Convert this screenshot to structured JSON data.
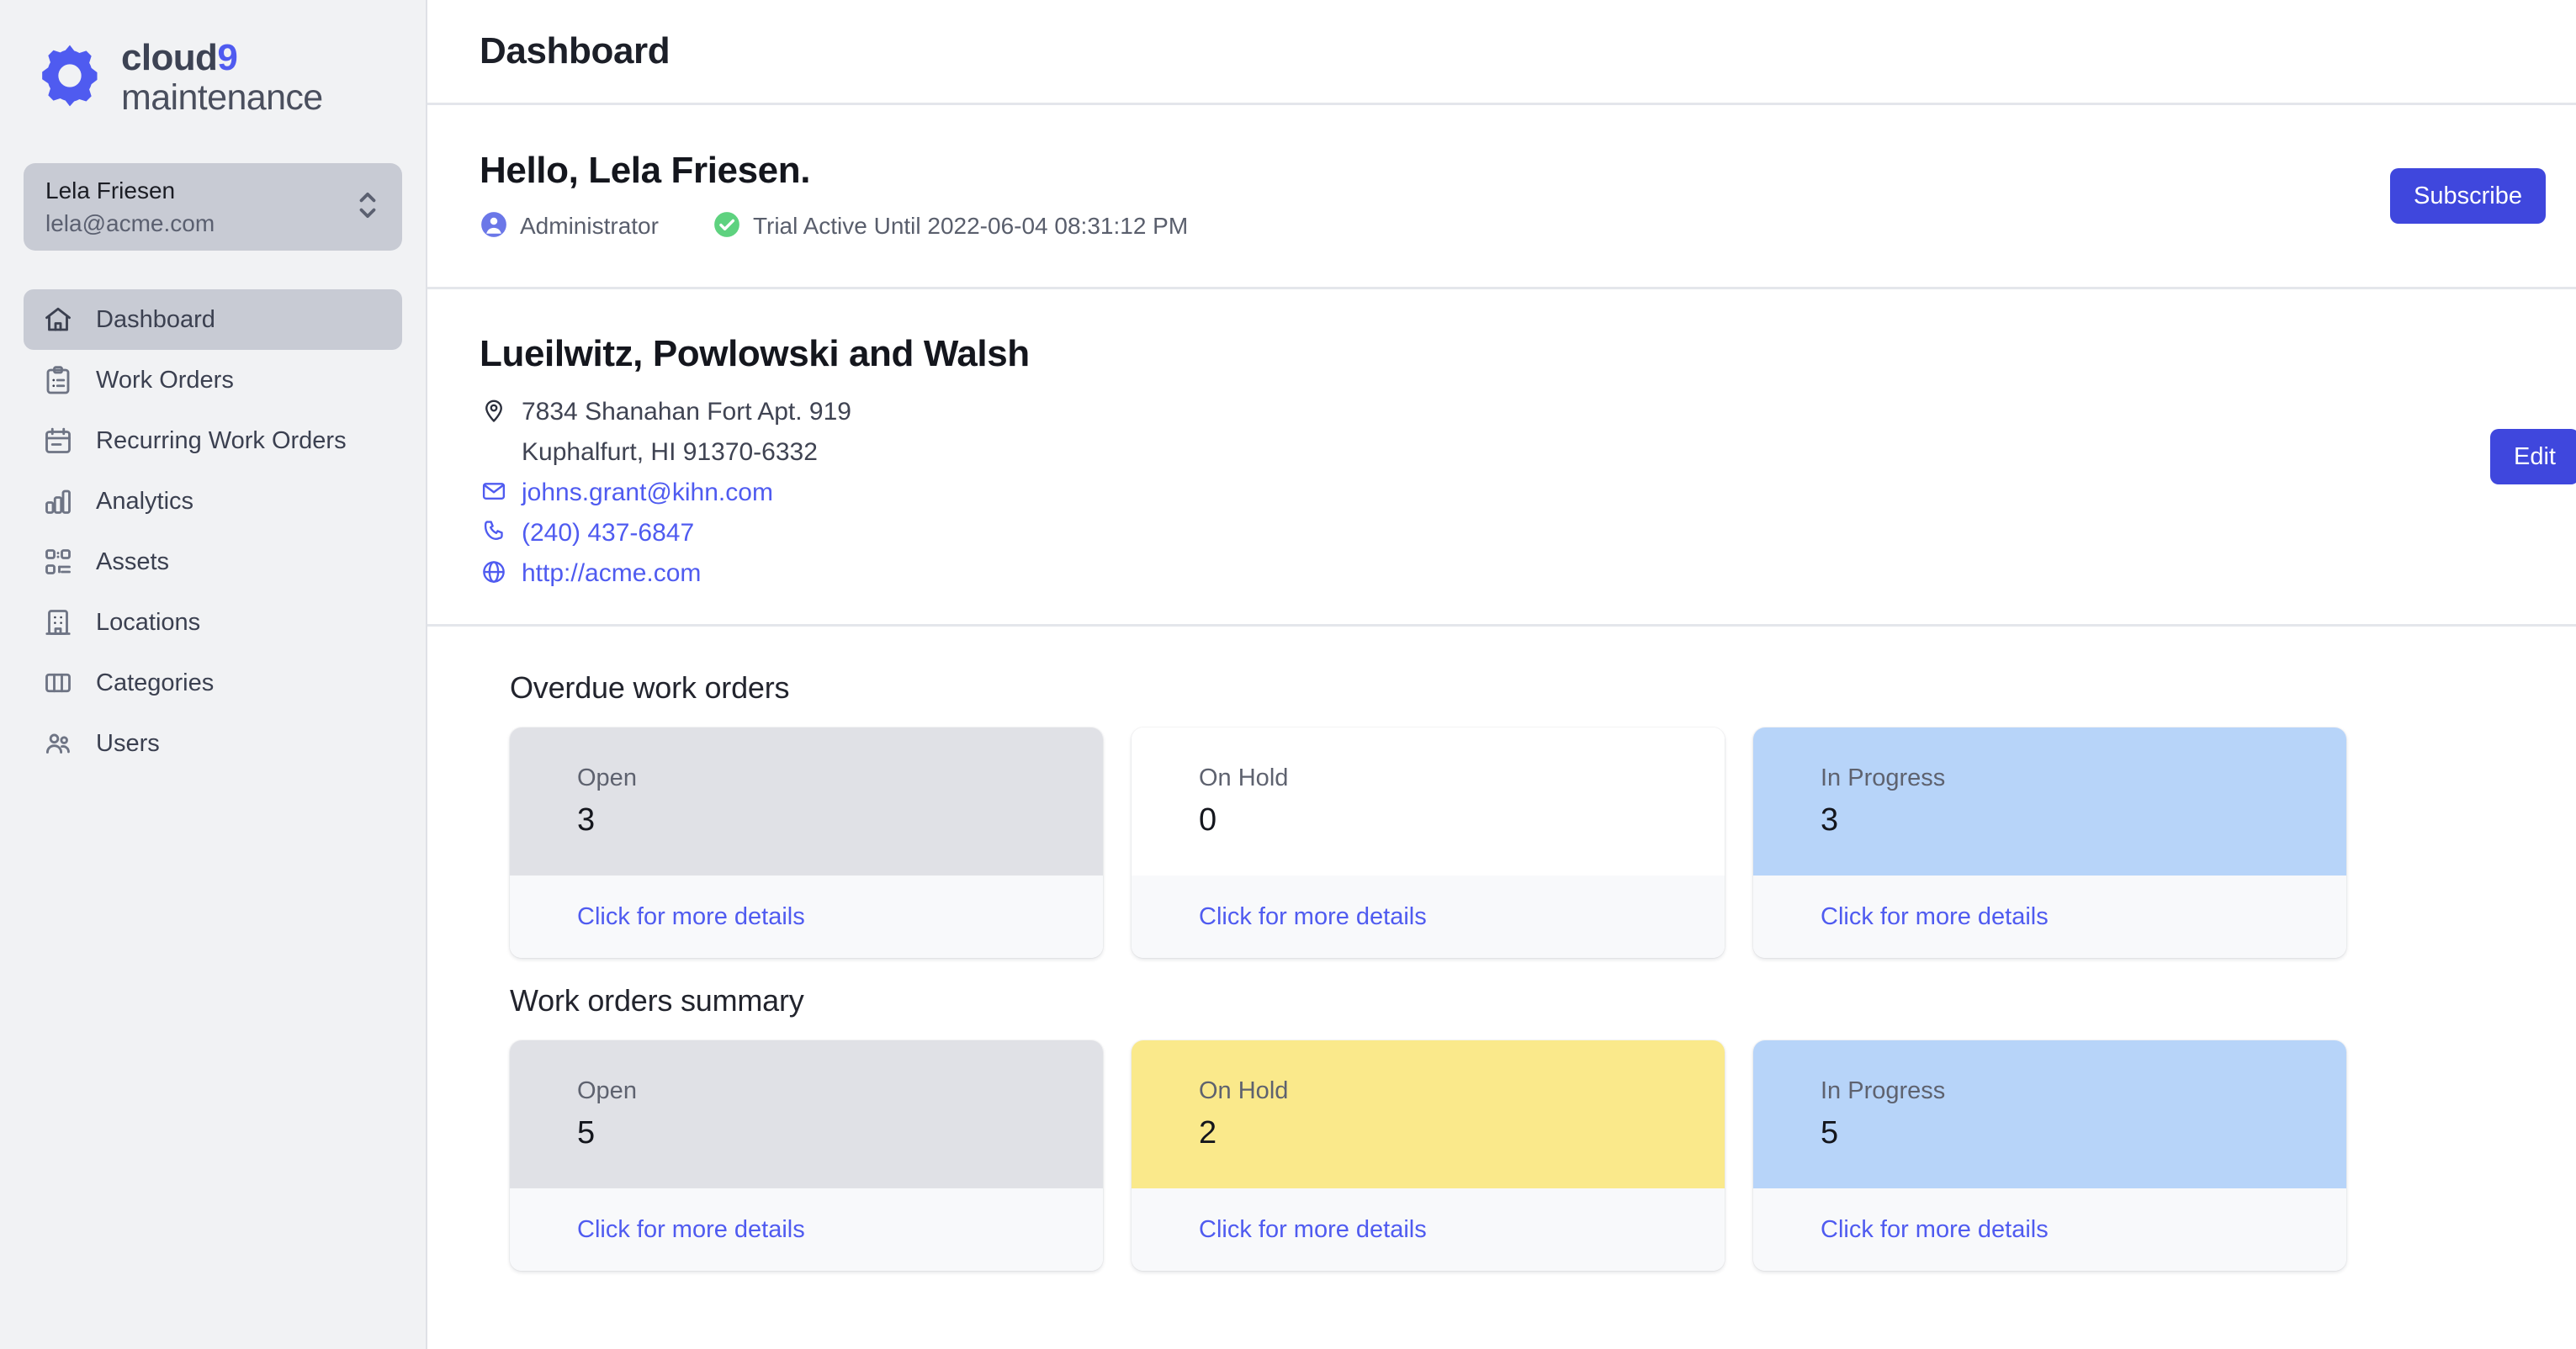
{
  "brand": {
    "line1_main": "cloud",
    "line1_accent": "9",
    "line2": "maintenance",
    "logo_icon": "gear-icon",
    "accent_color": "#4f5bf0"
  },
  "sidebar": {
    "user": {
      "name": "Lela Friesen",
      "email": "lela@acme.com",
      "selector_icon": "chevron-up-down-icon"
    },
    "items": [
      {
        "label": "Dashboard",
        "icon": "home-icon",
        "active": true
      },
      {
        "label": "Work Orders",
        "icon": "clipboard-list-icon",
        "active": false
      },
      {
        "label": "Recurring Work Orders",
        "icon": "calendar-icon",
        "active": false
      },
      {
        "label": "Analytics",
        "icon": "bar-chart-icon",
        "active": false
      },
      {
        "label": "Assets",
        "icon": "qr-code-icon",
        "active": false
      },
      {
        "label": "Locations",
        "icon": "building-icon",
        "active": false
      },
      {
        "label": "Categories",
        "icon": "columns-icon",
        "active": false
      },
      {
        "label": "Users",
        "icon": "users-icon",
        "active": false
      }
    ]
  },
  "header": {
    "title": "Dashboard"
  },
  "greeting": {
    "title": "Hello, Lela Friesen.",
    "role": "Administrator",
    "role_icon": "user-circle-icon",
    "trial_status": "Trial Active Until 2022-06-04 08:31:12 PM",
    "trial_icon": "check-circle-icon",
    "subscribe_label": "Subscribe"
  },
  "company": {
    "name": "Lueilwitz, Powlowski and Walsh",
    "address_line1": "7834 Shanahan Fort Apt. 919",
    "address_line2": "Kuphalfurt, HI 91370-6332",
    "address_icon": "map-pin-icon",
    "email": "johns.grant@kihn.com",
    "email_icon": "envelope-icon",
    "phone": "(240) 437-6847",
    "phone_icon": "phone-icon",
    "website": "http://acme.com",
    "website_icon": "globe-icon",
    "edit_label": "Edit"
  },
  "sections": [
    {
      "title": "Overdue work orders",
      "cards": [
        {
          "label": "Open",
          "value": "3",
          "color": "#e0e1e6",
          "link": "Click for more details"
        },
        {
          "label": "On Hold",
          "value": "0",
          "color": "#ffffff",
          "link": "Click for more details"
        },
        {
          "label": "In Progress",
          "value": "3",
          "color": "#b7d4f9",
          "link": "Click for more details"
        }
      ]
    },
    {
      "title": "Work orders summary",
      "cards": [
        {
          "label": "Open",
          "value": "5",
          "color": "#e0e1e6",
          "link": "Click for more details"
        },
        {
          "label": "On Hold",
          "value": "2",
          "color": "#fae98b",
          "link": "Click for more details"
        },
        {
          "label": "In Progress",
          "value": "5",
          "color": "#b7d4f9",
          "link": "Click for more details"
        }
      ]
    }
  ]
}
